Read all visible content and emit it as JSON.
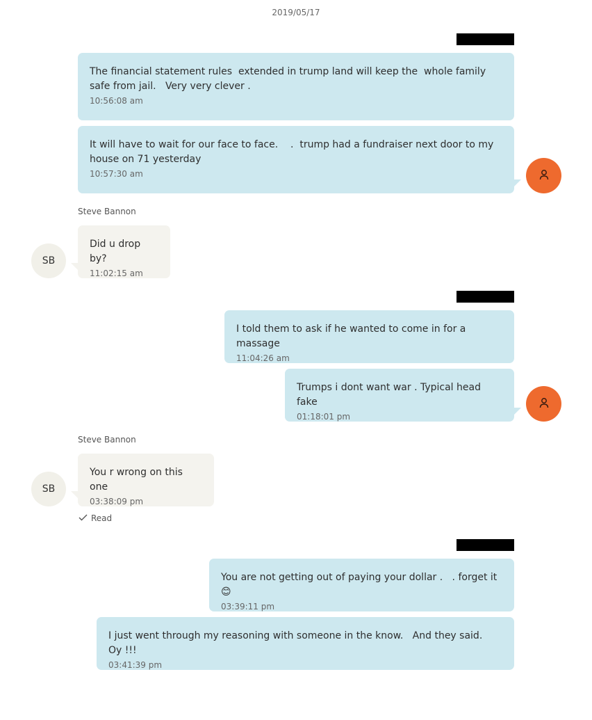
{
  "date_header": "2019/05/17",
  "contact": {
    "name": "Steve Bannon",
    "initials": "SB"
  },
  "colors": {
    "outgoing_bubble": "#cde8ef",
    "incoming_bubble": "#f4f3ee",
    "my_avatar": "#ee6a2e",
    "contact_avatar": "#f1f0e9",
    "redaction": "#000000"
  },
  "icons": {
    "my_avatar": "person-icon",
    "read_status": "checkmark-icon"
  },
  "messages": [
    {
      "direction": "outgoing",
      "text": "The financial statement rules  extended in trump land will keep the  whole family safe from jail.   Very very clever .",
      "time": "10:56:08 am"
    },
    {
      "direction": "outgoing",
      "text": "It will have to wait for our face to face.    .  trump had a fundraiser next door to my house on 71 yesterday",
      "time": "10:57:30 am"
    },
    {
      "direction": "incoming",
      "sender": "Steve Bannon",
      "text": "Did u drop by?",
      "time": "11:02:15 am"
    },
    {
      "direction": "outgoing",
      "text": "I told them to ask if he wanted to come in for a massage",
      "time": "11:04:26 am"
    },
    {
      "direction": "outgoing",
      "text": "Trumps i dont want war . Typical head fake",
      "time": "01:18:01 pm"
    },
    {
      "direction": "incoming",
      "sender": "Steve Bannon",
      "text": "You r wrong on this one",
      "time": "03:38:09 pm"
    },
    {
      "direction": "outgoing",
      "text": "You are not getting out of paying your dollar .   . forget it 😊",
      "time": "03:39:11 pm"
    },
    {
      "direction": "outgoing",
      "text": "I just went through my reasoning with someone in the know.   And they said.   Oy !!!",
      "time": "03:41:39 pm"
    }
  ],
  "read_receipt": "Read"
}
